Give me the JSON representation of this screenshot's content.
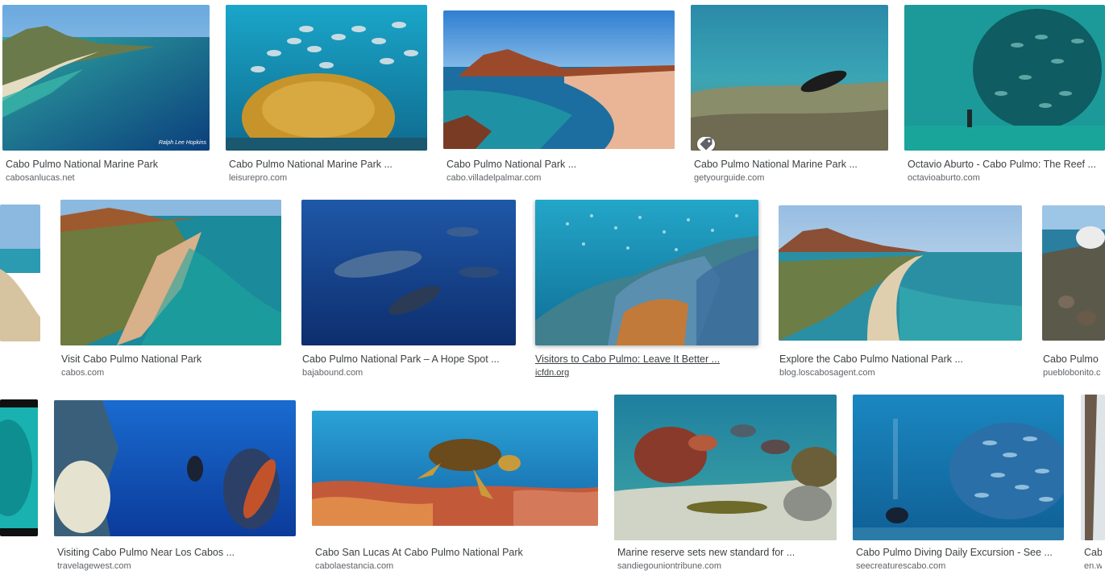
{
  "results": [
    {
      "title": "Cabo Pulmo National Marine Park",
      "source": "cabosanlucas.net",
      "credit": "Ralph Lee Hopkins"
    },
    {
      "title": "Cabo Pulmo National Marine Park ...",
      "source": "leisurepro.com"
    },
    {
      "title": "Cabo Pulmo National Park ...",
      "source": "cabo.villadelpalmar.com"
    },
    {
      "title": "Cabo Pulmo National Marine Park ...",
      "source": "getyourguide.com",
      "badge_icon": "product-tag-icon"
    },
    {
      "title": "Octavio Aburto - Cabo Pulmo: The Reef ...",
      "source": "octavioaburto.com"
    },
    {
      "title": "",
      "source": ""
    },
    {
      "title": "Visit Cabo Pulmo National Park",
      "source": "cabos.com"
    },
    {
      "title": "Cabo Pulmo National Park – A Hope Spot ...",
      "source": "bajabound.com"
    },
    {
      "title": "Visitors to Cabo Pulmo: Leave It Better ...",
      "source": "icfdn.org"
    },
    {
      "title": "Explore the Cabo Pulmo National Park ...",
      "source": "blog.loscabosagent.com"
    },
    {
      "title": "Cabo Pulmo N",
      "source": "pueblobonito.c"
    },
    {
      "title": "",
      "source": ""
    },
    {
      "title": "Visiting Cabo Pulmo Near Los Cabos ...",
      "source": "travelagewest.com"
    },
    {
      "title": "Cabo San Lucas At Cabo Pulmo National Park",
      "source": "cabolaestancia.com"
    },
    {
      "title": "Marine reserve sets new standard for ...",
      "source": "sandiegouniontribune.com"
    },
    {
      "title": "Cabo Pulmo Diving Daily Excursion - See ...",
      "source": "seecreaturescabo.com"
    },
    {
      "title": "Cabo",
      "source": "en.wi"
    }
  ]
}
